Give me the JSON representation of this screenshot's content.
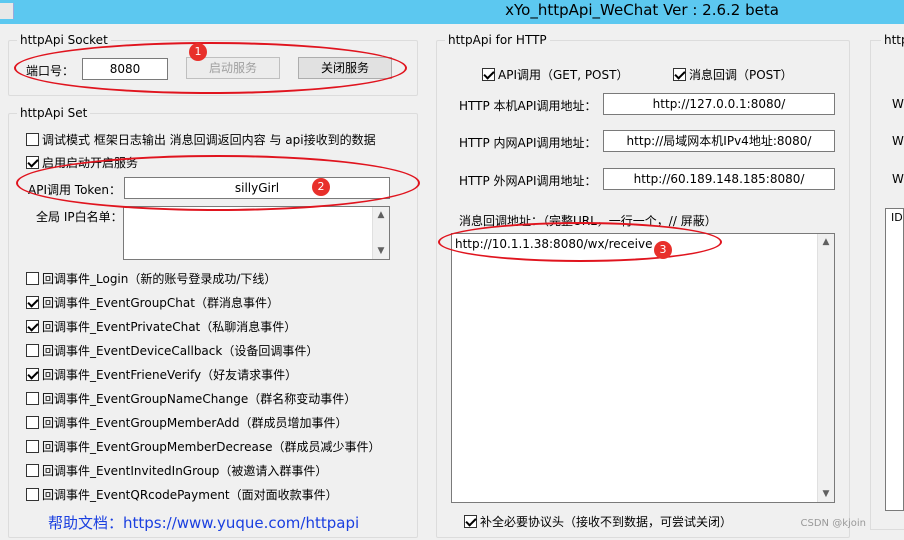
{
  "window": {
    "title": "xYo_httpApi_WeChat   Ver : 2.6.2 beta"
  },
  "socket": {
    "group_title": "httpApi Socket",
    "port_label": "端口号：",
    "port_value": "8080",
    "start_label": "启动服务",
    "stop_label": "关闭服务"
  },
  "set": {
    "group_title": "httpApi Set",
    "debug_label": "调试模式  框架日志输出 消息回调返回内容 与 api接收到的数据",
    "autostart_label": "启用启动开启服务",
    "token_label": "API调用 Token：",
    "token_value": "sillyGirl",
    "whitelist_label": "全局 IP白名单：",
    "events": [
      {
        "label": "回调事件_Login（新的账号登录成功/下线）",
        "checked": false
      },
      {
        "label": "回调事件_EventGroupChat（群消息事件）",
        "checked": true
      },
      {
        "label": "回调事件_EventPrivateChat（私聊消息事件）",
        "checked": true
      },
      {
        "label": "回调事件_EventDeviceCallback（设备回调事件）",
        "checked": false
      },
      {
        "label": "回调事件_EventFrieneVerify（好友请求事件）",
        "checked": true
      },
      {
        "label": "回调事件_EventGroupNameChange（群名称变动事件）",
        "checked": false
      },
      {
        "label": "回调事件_EventGroupMemberAdd（群成员增加事件）",
        "checked": false
      },
      {
        "label": "回调事件_EventGroupMemberDecrease（群成员减少事件）",
        "checked": false
      },
      {
        "label": "回调事件_EventInvitedInGroup（被邀请入群事件）",
        "checked": false
      },
      {
        "label": "回调事件_EventQRcodePayment（面对面收款事件）",
        "checked": false
      }
    ],
    "help_link": "帮助文档：https://www.yuque.com/httpapi"
  },
  "http": {
    "group_title": "httpApi for HTTP",
    "api_call_label": "API调用（GET, POST）",
    "msg_callback_label": "消息回调（POST）",
    "local_label": "HTTP 本机API调用地址：",
    "local_value": "http://127.0.0.1:8080/",
    "lan_label": "HTTP 内网API调用地址：",
    "lan_value": "http://局域网本机IPv4地址:8080/",
    "wan_label": "HTTP 外网API调用地址：",
    "wan_value": "http://60.189.148.185:8080/",
    "callback_label": "消息回调地址：（完整URL，一行一个，// 屏蔽）",
    "callback_value": "http://10.1.1.38:8080/wx/receive",
    "complete_header_label": "补全必要协议头（接收不到数据，可尝试关闭）"
  },
  "right": {
    "group_title": "http",
    "row_label": "W",
    "col_header": "ID"
  },
  "annotations": [
    "1",
    "2",
    "3"
  ],
  "watermark": "CSDN @kjoin",
  "colors": {
    "titlebar": "#5cc8f0",
    "annotation_red": "#e0141e",
    "link_blue": "#1a3fe0"
  }
}
